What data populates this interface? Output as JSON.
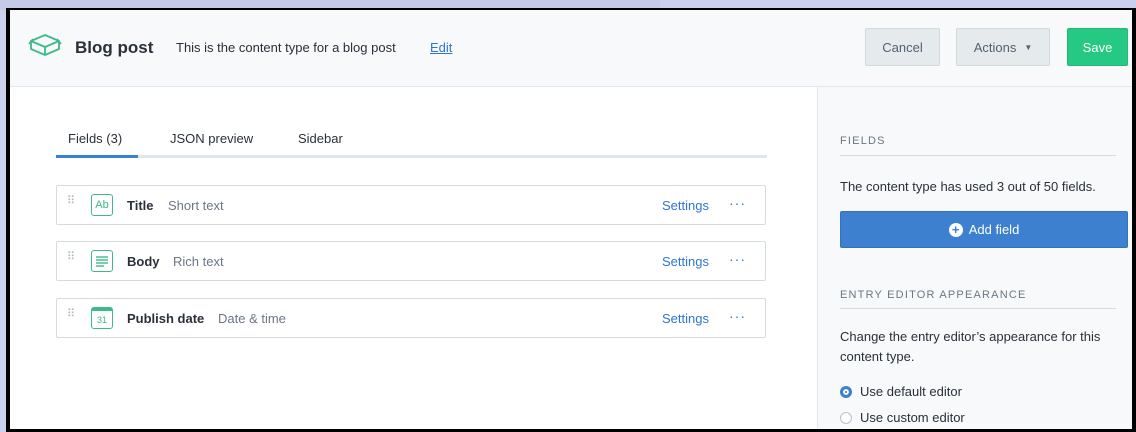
{
  "header": {
    "content_type_name": "Blog post",
    "description": "This is the content type for a blog post",
    "edit_link": "Edit",
    "cancel_label": "Cancel",
    "actions_label": "Actions",
    "save_label": "Save"
  },
  "tabs": [
    {
      "label": "Fields (3)",
      "active": true
    },
    {
      "label": "JSON preview",
      "active": false
    },
    {
      "label": "Sidebar",
      "active": false
    }
  ],
  "fields": [
    {
      "name": "Title",
      "type": "Short text",
      "icon": "short-text-icon",
      "icon_text": "Ab",
      "settings_label": "Settings",
      "more_label": "···"
    },
    {
      "name": "Body",
      "type": "Rich text",
      "icon": "rich-text-icon",
      "settings_label": "Settings",
      "more_label": "···"
    },
    {
      "name": "Publish date",
      "type": "Date & time",
      "icon": "calendar-icon",
      "icon_text": "31",
      "settings_label": "Settings",
      "more_label": "···"
    }
  ],
  "sidebar": {
    "fields_heading": "FIELDS",
    "fields_usage": "The content type has used 3 out of 50 fields.",
    "add_field_label": "Add field",
    "appearance_heading": "ENTRY EDITOR APPEARANCE",
    "appearance_text": "Change the entry editor’s appearance for this content type.",
    "options": [
      {
        "label": "Use default editor",
        "selected": true
      },
      {
        "label": "Use custom editor",
        "selected": false
      }
    ]
  },
  "colors": {
    "accent_blue": "#3c80cf",
    "save_green": "#26c983",
    "field_icon_green": "#3dba86",
    "link_blue": "#2e75d4"
  }
}
